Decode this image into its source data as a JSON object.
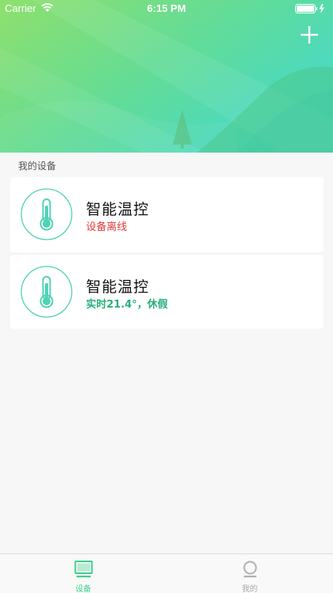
{
  "status_bar": {
    "carrier": "Carrier",
    "time": "6:15 PM"
  },
  "header": {
    "gradient_colors": [
      "#8ede6e",
      "#4fd9b4"
    ],
    "add_icon": "plus-icon"
  },
  "section": {
    "title": "我的设备"
  },
  "devices": [
    {
      "name": "智能温控",
      "status": "设备离线",
      "status_color": "#e03a3a",
      "icon": "thermometer-icon"
    },
    {
      "name": "智能温控",
      "status": "实时21.4°，休假",
      "status_color": "#28b07a",
      "icon": "thermometer-icon"
    }
  ],
  "tab_bar": {
    "tabs": [
      {
        "label": "设备",
        "icon": "monitor-icon",
        "active": true
      },
      {
        "label": "我的",
        "icon": "user-icon",
        "active": false
      }
    ],
    "active_color": "#3fcf8c",
    "inactive_color": "#aaaaaa"
  }
}
